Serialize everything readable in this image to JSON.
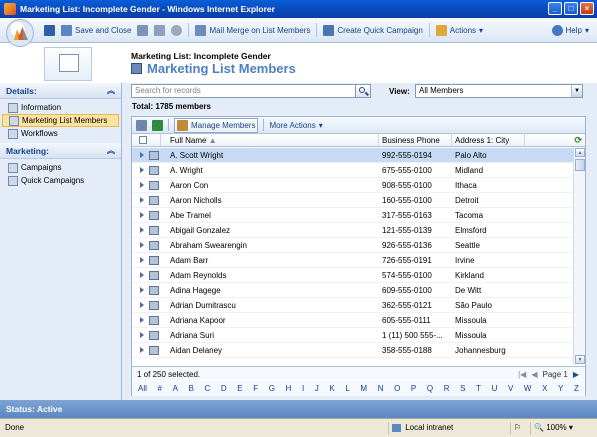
{
  "window": {
    "title": "Marketing List: Incomplete Gender - Windows Internet Explorer"
  },
  "toolbar": {
    "save_close": "Save and Close",
    "mail_merge": "Mail Merge on List Members",
    "create_campaign": "Create Quick Campaign",
    "actions": "Actions",
    "help": "Help"
  },
  "header": {
    "entity": "Marketing List: Incomplete Gender",
    "title": "Marketing List Members"
  },
  "nav": {
    "details_label": "Details:",
    "details_items": [
      "Information",
      "Marketing List Members",
      "Workflows"
    ],
    "marketing_label": "Marketing:",
    "marketing_items": [
      "Campaigns",
      "Quick Campaigns"
    ]
  },
  "search": {
    "placeholder": "Search for records"
  },
  "view": {
    "label": "View:",
    "value": "All Members"
  },
  "total": "Total: 1785 members",
  "grid_toolbar": {
    "manage": "Manage Members",
    "more": "More Actions"
  },
  "columns": {
    "name": "Full Name",
    "phone": "Business Phone",
    "city": "Address 1: City"
  },
  "rows": [
    {
      "name": "A. Scott Wright",
      "phone": "992-555-0194",
      "city": "Palo Alto"
    },
    {
      "name": "A. Wright",
      "phone": "675-555-0100",
      "city": "Midland"
    },
    {
      "name": "Aaron Con",
      "phone": "908-555-0100",
      "city": "Ithaca"
    },
    {
      "name": "Aaron Nicholls",
      "phone": "160-555-0100",
      "city": "Detroit"
    },
    {
      "name": "Abe Tramel",
      "phone": "317-555-0163",
      "city": "Tacoma"
    },
    {
      "name": "Abigail Gonzalez",
      "phone": "121-555-0139",
      "city": "Elmsford"
    },
    {
      "name": "Abraham Swearengin",
      "phone": "926-555-0136",
      "city": "Seattle"
    },
    {
      "name": "Adam Barr",
      "phone": "726-555-0191",
      "city": "Irvine"
    },
    {
      "name": "Adam Reynolds",
      "phone": "574-555-0100",
      "city": "Kirkland"
    },
    {
      "name": "Adina Hagege",
      "phone": "609-555-0100",
      "city": "De Witt"
    },
    {
      "name": "Adrian Dumitrascu",
      "phone": "362-555-0121",
      "city": "São Paulo"
    },
    {
      "name": "Adriana Kapoor",
      "phone": "605-555-0111",
      "city": "Missoula"
    },
    {
      "name": "Adriana Suri",
      "phone": "1 (11) 500 555-...",
      "city": "Missoula"
    },
    {
      "name": "Aidan Delaney",
      "phone": "358-555-0188",
      "city": "Johannesburg"
    }
  ],
  "footer": {
    "selected": "1 of 250 selected.",
    "page": "Page 1"
  },
  "alphabet": [
    "All",
    "#",
    "A",
    "B",
    "C",
    "D",
    "E",
    "F",
    "G",
    "H",
    "I",
    "J",
    "K",
    "L",
    "M",
    "N",
    "O",
    "P",
    "Q",
    "R",
    "S",
    "T",
    "U",
    "V",
    "W",
    "X",
    "Y",
    "Z"
  ],
  "status": "Status: Active",
  "ie_status": {
    "done": "Done",
    "zone": "Local intranet",
    "zoom": "100%"
  },
  "colors": {
    "selected_row": "#c6daf3",
    "accent": "#4d7fc4",
    "nav_selected": "#fbe3a1"
  }
}
